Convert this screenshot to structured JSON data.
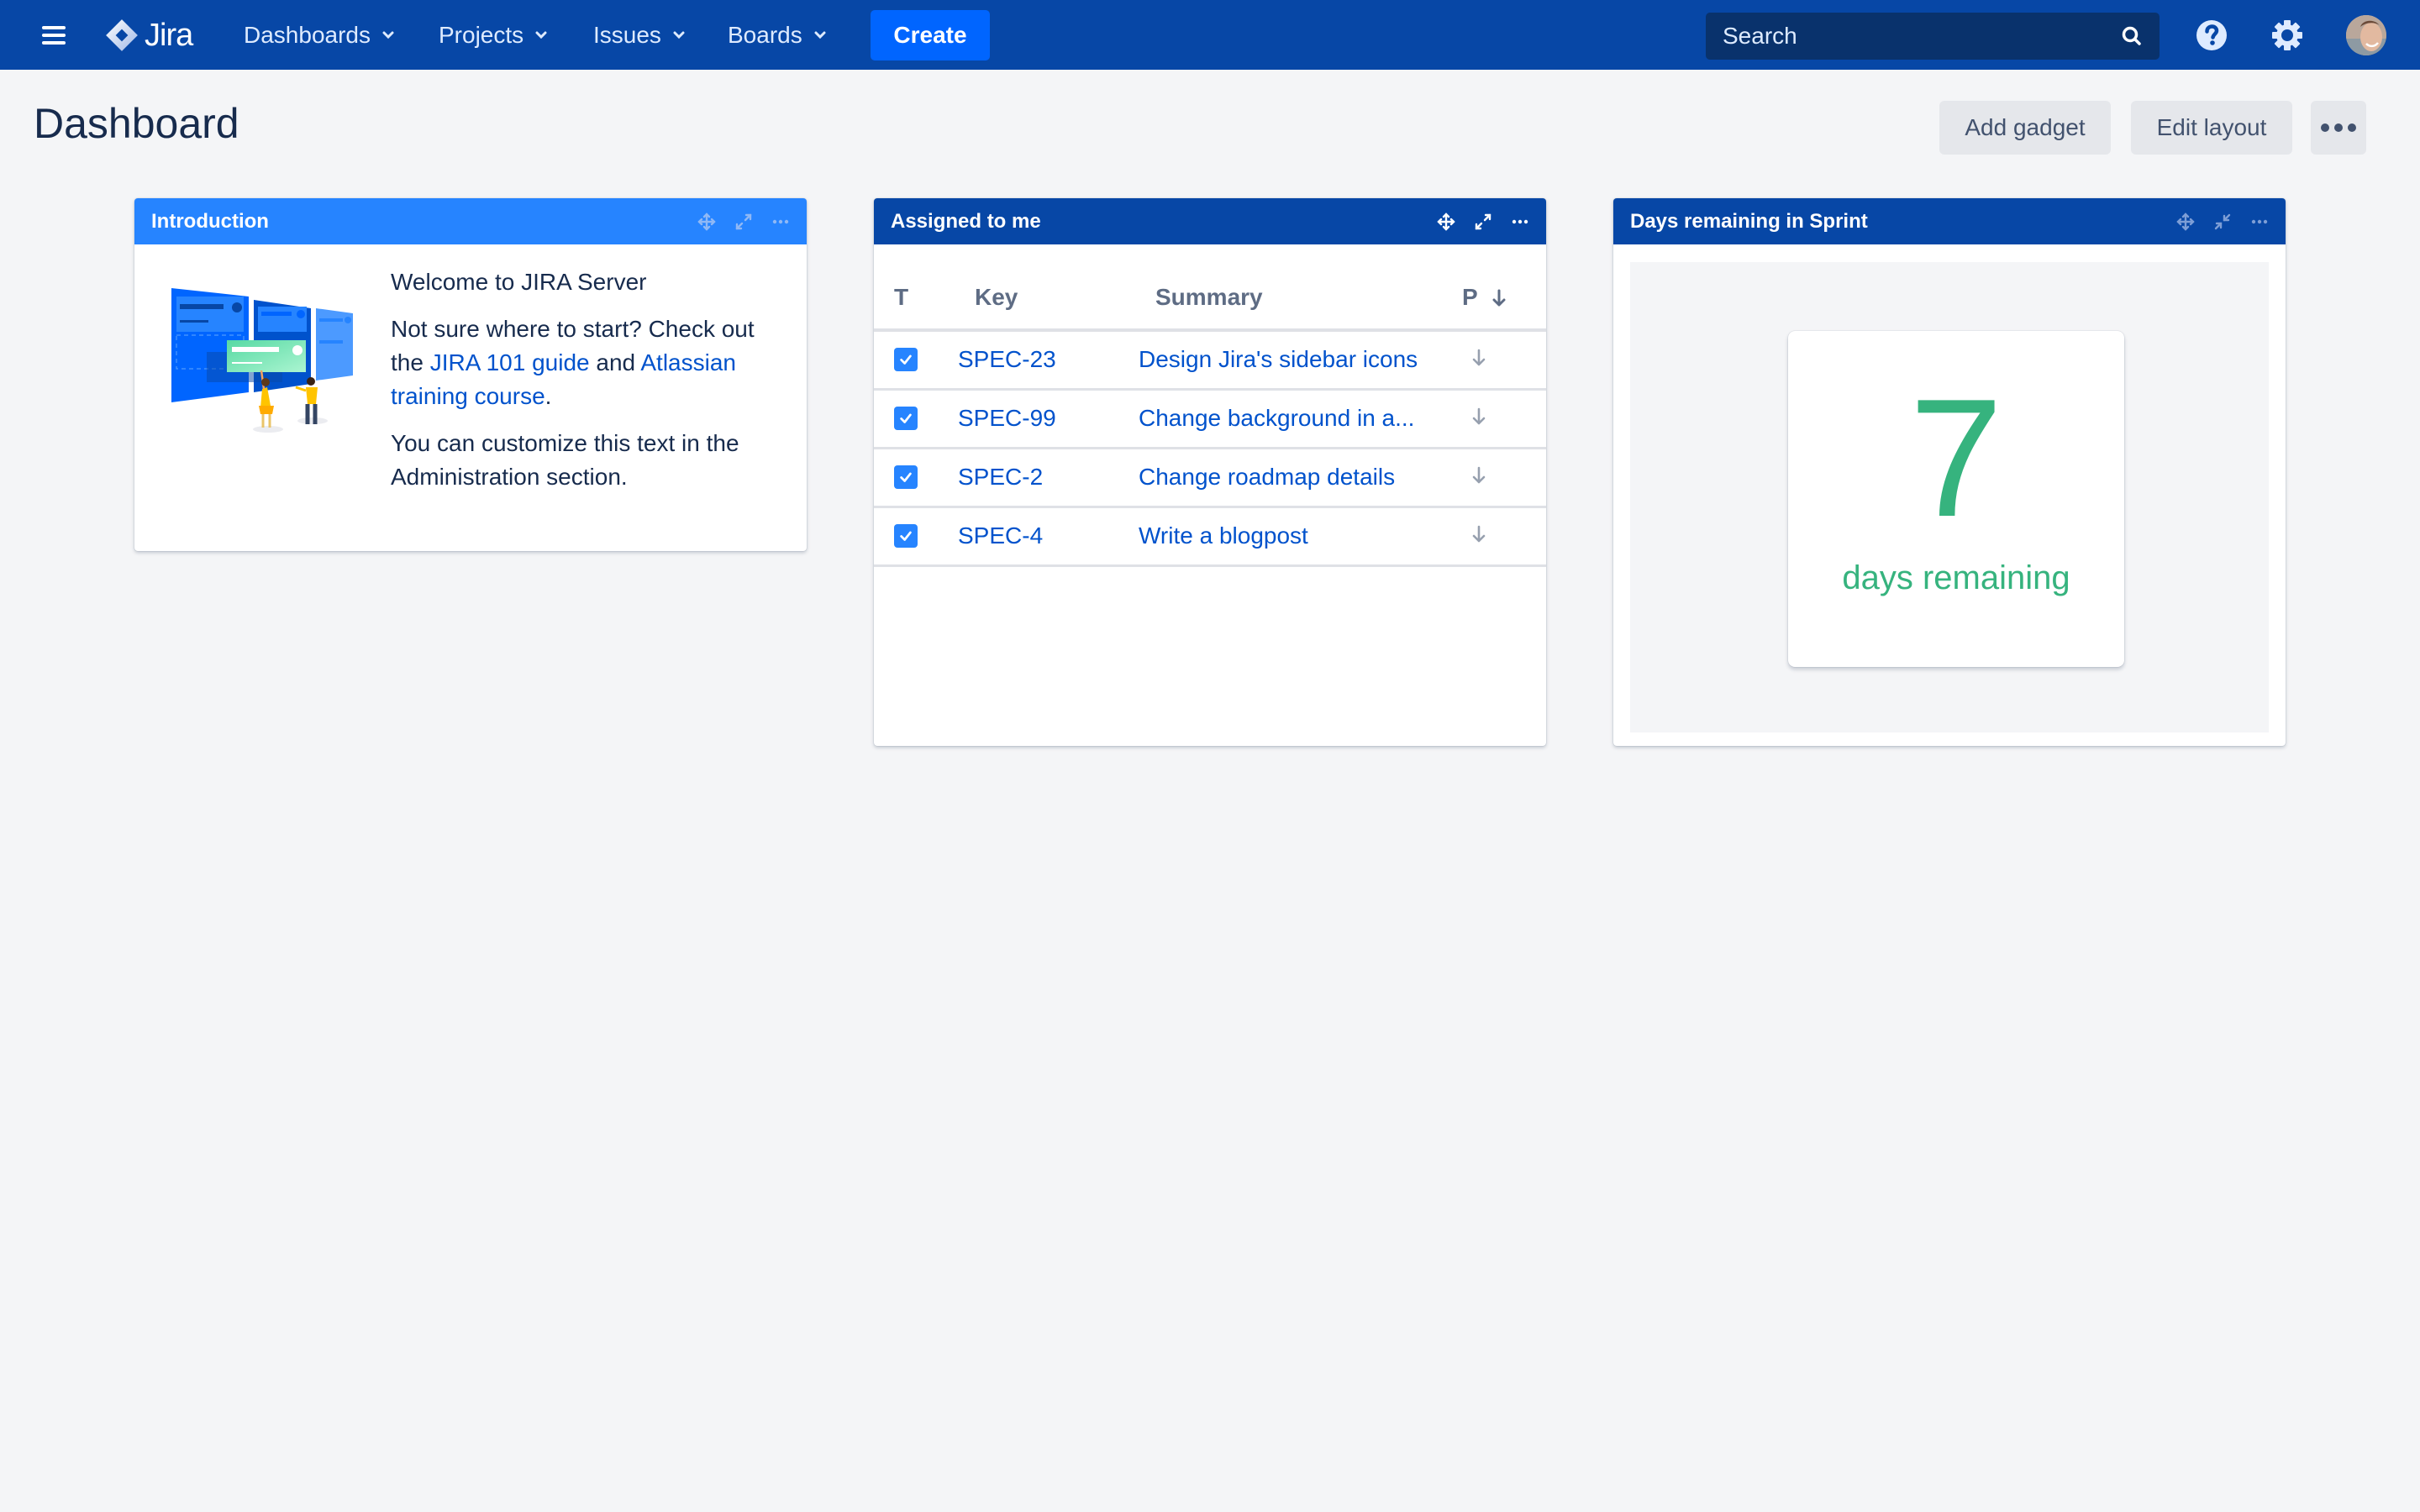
{
  "nav": {
    "logo_text": "Jira",
    "items": [
      {
        "label": "Dashboards"
      },
      {
        "label": "Projects"
      },
      {
        "label": "Issues"
      },
      {
        "label": "Boards"
      }
    ],
    "create_label": "Create",
    "search_placeholder": "Search",
    "icons": [
      "menu-icon",
      "jira-logo-icon",
      "search-icon",
      "help-icon",
      "settings-icon",
      "avatar"
    ]
  },
  "page": {
    "title": "Dashboard",
    "add_gadget_label": "Add gadget",
    "edit_layout_label": "Edit layout"
  },
  "colors": {
    "nav_bg": "#0747a6",
    "create_bg": "#0065ff",
    "intro_header": "#2684ff",
    "gadget_header": "#0747a6",
    "link": "#0052cc",
    "success": "#36b37e",
    "page_bg": "#f4f5f7"
  },
  "gadgets": {
    "intro": {
      "title": "Introduction",
      "welcome": "Welcome to JIRA Server",
      "line2_prefix": "Not sure where to start? Check out the ",
      "link1": "JIRA 101 guide",
      "line2_mid": " and ",
      "link2": "Atlassian training course",
      "line2_suffix": ".",
      "line3": "You can customize this text in the Administration section."
    },
    "assigned": {
      "title": "Assigned to me",
      "columns": {
        "type": "T",
        "key": "Key",
        "summary": "Summary",
        "priority": "P"
      },
      "rows": [
        {
          "key": "SPEC-23",
          "summary": "Design Jira's sidebar icons",
          "checked": true,
          "priority": "low"
        },
        {
          "key": "SPEC-99",
          "summary": "Change background in a...",
          "checked": true,
          "priority": "low"
        },
        {
          "key": "SPEC-2",
          "summary": "Change roadmap details",
          "checked": true,
          "priority": "low"
        },
        {
          "key": "SPEC-4",
          "summary": "Write a blogpost",
          "checked": true,
          "priority": "low"
        }
      ]
    },
    "sprint": {
      "title": "Days remaining in Sprint",
      "days": "7",
      "label": "days remaining"
    }
  }
}
